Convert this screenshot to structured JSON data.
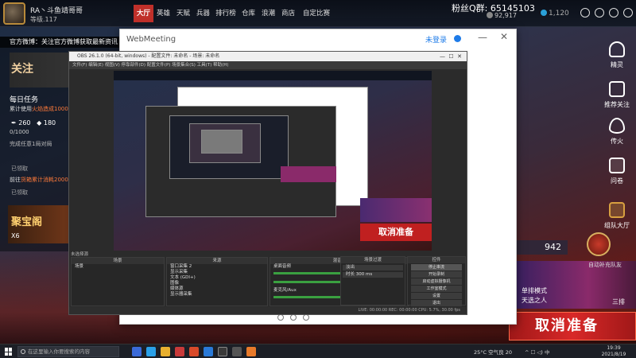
{
  "game": {
    "player_name": "RA丶斗鱼靖哥哥",
    "player_level": "等级.117",
    "nav": [
      {
        "label": "大厅",
        "active": true
      },
      {
        "label": "英雄",
        "active": false
      },
      {
        "label": "天赋",
        "active": false
      },
      {
        "label": "兵器",
        "active": false
      },
      {
        "label": "排行榜",
        "active": false
      },
      {
        "label": "仓库",
        "active": false
      },
      {
        "label": "浪潮",
        "active": false
      },
      {
        "label": "商店",
        "active": false
      },
      {
        "label": "自定比赛",
        "active": false
      }
    ],
    "qq_group": "粉丝Q群:  65145103",
    "fans": "92,917",
    "coins": "1,120",
    "weibo_notice": "官方微博：关注官方微博获取最新资讯",
    "follow_banner": "关注",
    "task_title": "每日任务",
    "task_desc_prefix": "累计使用",
    "task_desc_highlight": "火焰造成1000点",
    "task_stats_a": "260",
    "task_stats_b": "180",
    "task_progress": "0/1000",
    "task_complete": "完成任意1局对局",
    "task_claimed_1": "已领取",
    "task_desc2_prefix": "前往",
    "task_desc2_highlight": "货箱累计消耗20000",
    "task_claimed_2": "已领取",
    "treasure_label": "聚宝阁",
    "treasure_count": "X6",
    "right_sidebar": [
      {
        "label": "精灵",
        "icon": "headset-icon"
      },
      {
        "label": "推荐关注",
        "icon": "camera-icon"
      },
      {
        "label": "传火",
        "icon": "flame-icon"
      },
      {
        "label": "问卷",
        "icon": "survey-icon"
      },
      {
        "label": "组队大厅",
        "icon": "team-icon"
      }
    ],
    "match_count": "942",
    "auto_match": "自动补充队友",
    "mode_label": "单排模式",
    "mode_sub": "天选之人",
    "mode_tag": "三排",
    "cancel_match": "取消准备"
  },
  "webmeeting": {
    "title": "WebMeeting",
    "login": "未登录",
    "min": "—",
    "close": "✕"
  },
  "obs": {
    "title": "OBS 26.1.0 (64-bit, windows) - 配置文件: 未命名 - 场景: 未命名",
    "menu": "文件(F)  编辑(E)  视图(V)  停靠部件(D)  配置文件(P)  场景集合(S)  工具(T)  帮助(H)",
    "status_left": "未选择源",
    "docks": {
      "scenes": {
        "title": "场景",
        "items": [
          "场景"
        ]
      },
      "sources": {
        "title": "来源",
        "items": [
          "窗口采集 2",
          "显示采集",
          "文本 (GDI+)",
          "图像",
          "媒体源",
          "显示器采集"
        ]
      },
      "mixer": {
        "title": "混音器",
        "items": [
          "桌面音频",
          "麦克风/Aux"
        ]
      },
      "transitions": {
        "title": "场景过渡",
        "items": [
          "淡出",
          "时长  300 ms"
        ]
      },
      "controls": {
        "title": "控件",
        "items": [
          "停止串流",
          "开始录制",
          "启动虚拟摄像机",
          "工作室模式",
          "设置",
          "退出"
        ]
      }
    },
    "footer": "LIVE: 00:00:00   REC: 00:00:00   CPU: 5.7%, 30.00 fps"
  },
  "preview": {
    "cancel_label": "取消准备"
  },
  "taskbar": {
    "search_placeholder": "在这里输入你要搜索的内容",
    "weather": "25°C 空气良 20",
    "tray": "^  ☐  ◁)  中",
    "time": "19:39",
    "date": "2021/8/19"
  },
  "colors": {
    "accent_red": "#c0302a",
    "link_blue": "#1e7be8",
    "gold": "#d8b060"
  }
}
